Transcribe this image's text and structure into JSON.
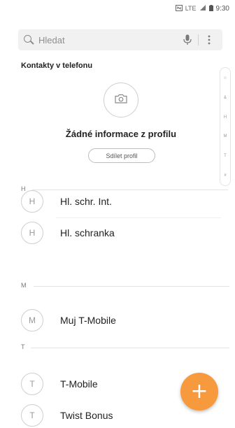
{
  "status_bar": {
    "signal_text": "LTE",
    "time": "9:30"
  },
  "search": {
    "placeholder": "Hledat"
  },
  "section_title": "Kontakty v telefonu",
  "profile": {
    "title": "Žádné informace z profilu",
    "share_label": "Sdílet profil"
  },
  "index_letters": [
    "☆",
    "&",
    "H",
    "M",
    "T",
    "#"
  ],
  "groups": [
    {
      "header": "H",
      "contacts": [
        {
          "initial": "H",
          "name": "Hl. schr. Int."
        },
        {
          "initial": "H",
          "name": "Hl. schranka"
        }
      ]
    },
    {
      "header": "M",
      "contacts": [
        {
          "initial": "M",
          "name": "Muj T-Mobile"
        }
      ]
    },
    {
      "header": "T",
      "contacts": [
        {
          "initial": "T",
          "name": "T-Mobile"
        },
        {
          "initial": "T",
          "name": "Twist Bonus"
        }
      ]
    }
  ],
  "fab": {
    "label": "+"
  },
  "colors": {
    "accent": "#f79a3e",
    "search_bg": "#f1f1f1"
  },
  "icons": {
    "search": "search-icon",
    "mic": "mic-icon",
    "more": "more-vert-icon",
    "camera": "camera-icon"
  }
}
